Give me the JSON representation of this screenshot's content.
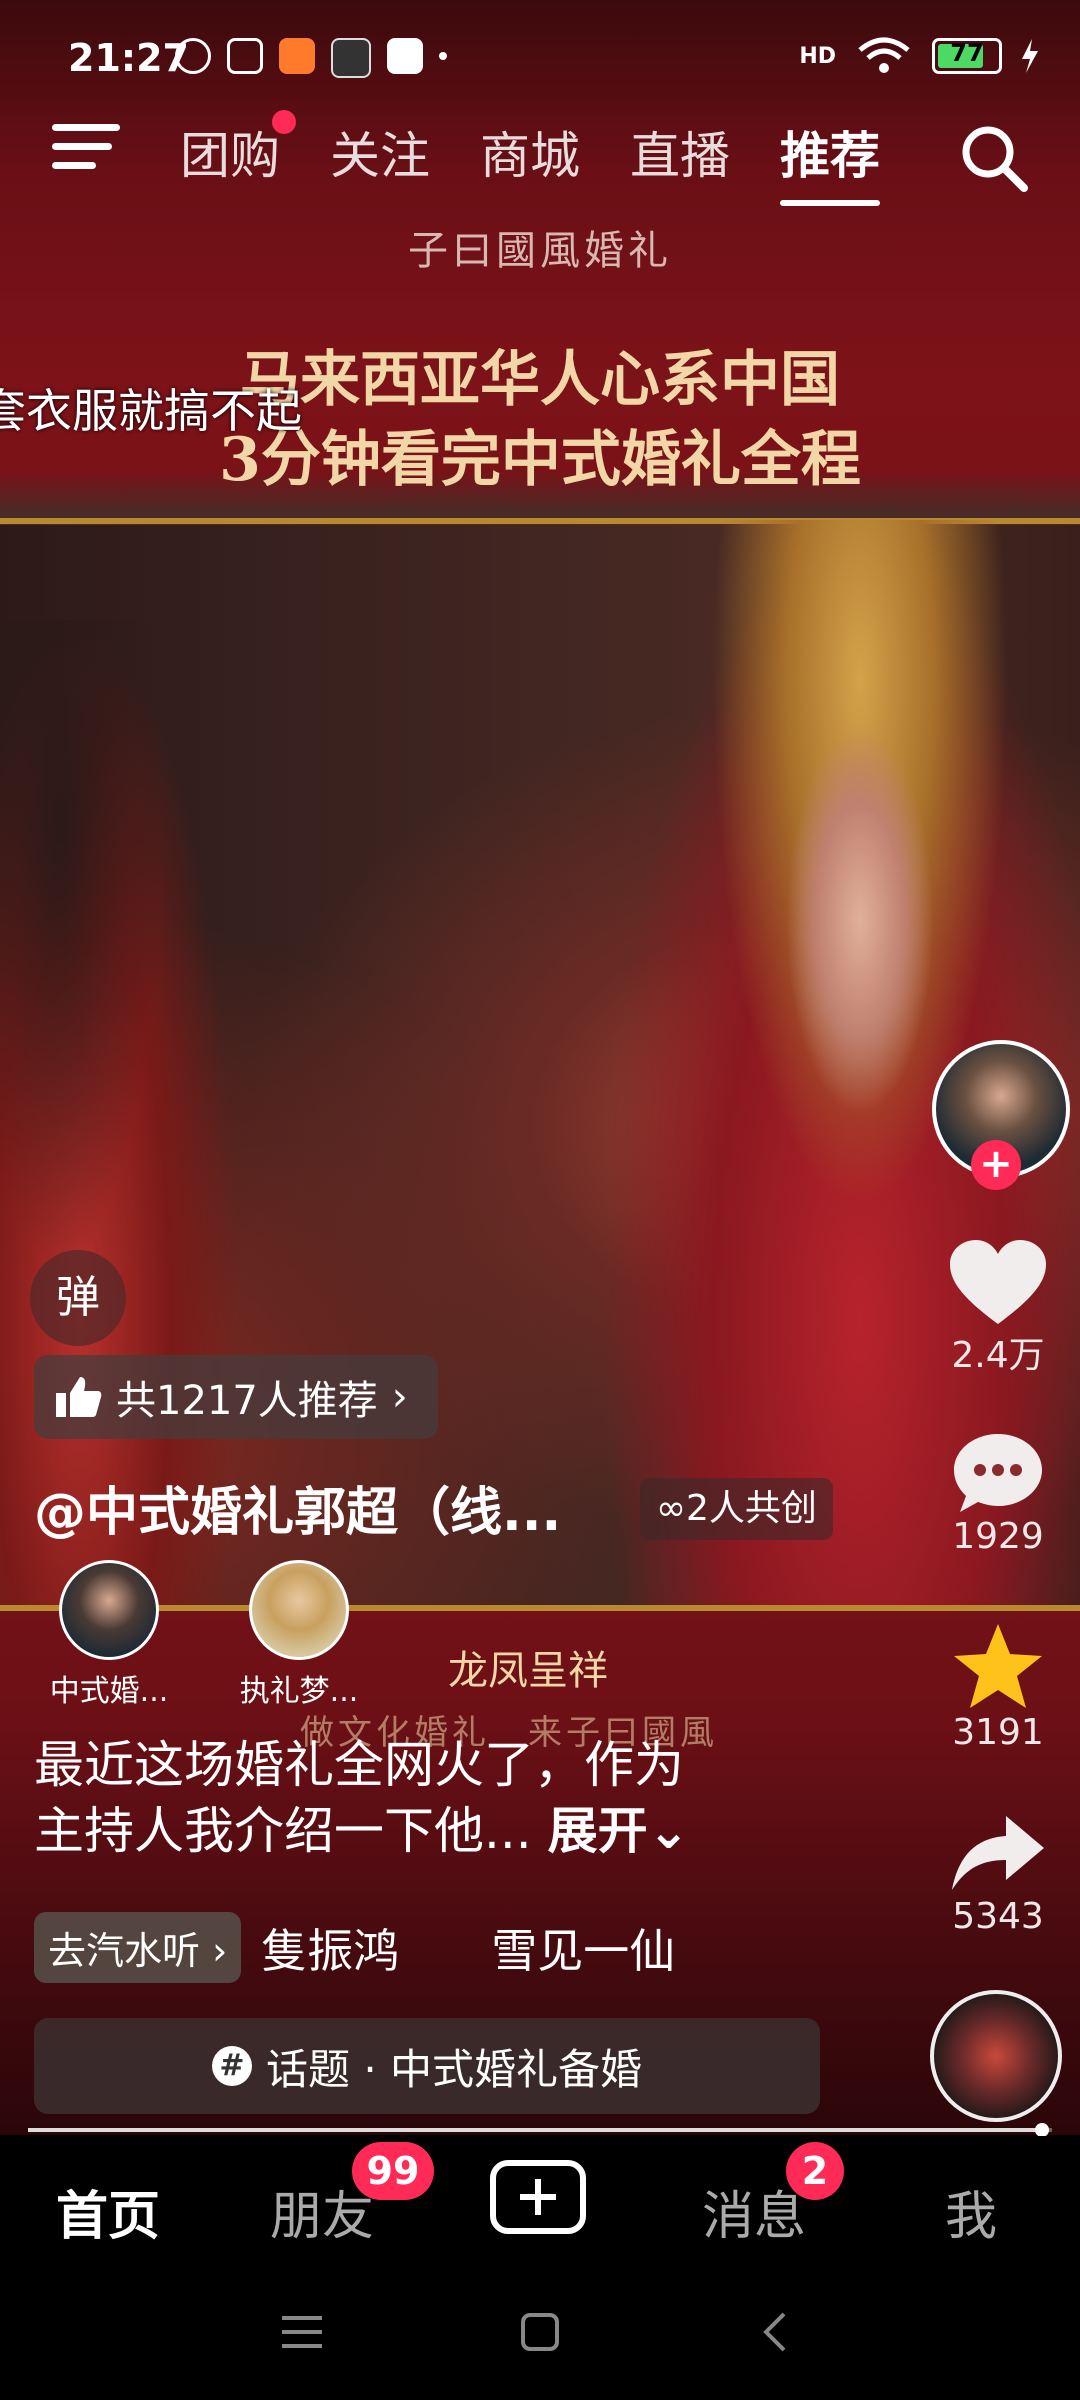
{
  "status_bar": {
    "time": "21:27",
    "battery": "77",
    "battery_level": 0.77,
    "signal_label": "HD"
  },
  "top_nav": {
    "tabs": [
      {
        "label": "团购",
        "active": false,
        "dot": true
      },
      {
        "label": "关注",
        "active": false
      },
      {
        "label": "商城",
        "active": false
      },
      {
        "label": "直播",
        "active": false
      },
      {
        "label": "推荐",
        "active": true
      }
    ]
  },
  "video": {
    "brand_text": "子曰國風婚礼",
    "headline_line1": "马来西亚华人心系中国",
    "headline_line2": "3分钟看完中式婚礼全程",
    "danmaku": "套衣服就搞不起",
    "seal_text": "龙凤呈祥",
    "slogan": "做文化婚礼　来子曰國風"
  },
  "actions": {
    "likes": "2.4万",
    "comments": "1929",
    "favorites": "3191",
    "shares": "5343"
  },
  "overlay": {
    "danmu_button": "弹",
    "recommend_pill": "共1217人推荐",
    "author": "@中式婚礼郭超（线...",
    "cocreate": "2人共创",
    "co_creators": [
      {
        "name": "中式婚..."
      },
      {
        "name": "执礼梦..."
      }
    ],
    "caption_line1": "最近这场婚礼全网火了，作为",
    "caption_line2": "主持人我介绍一下他...",
    "expand": "展开",
    "music_pill": "去汽水听",
    "music_text": "隻振鸿　　雪见一仙",
    "topic": "话题 · 中式婚礼备婚",
    "progress": 0.99
  },
  "bottom_nav": {
    "home": "首页",
    "friends": "朋友",
    "friends_badge": "99",
    "messages": "消息",
    "messages_badge": "2",
    "me": "我"
  },
  "colors": {
    "accent": "#ff2a55",
    "headline": "#f1d7a7",
    "gold_line": "#b8892f"
  }
}
